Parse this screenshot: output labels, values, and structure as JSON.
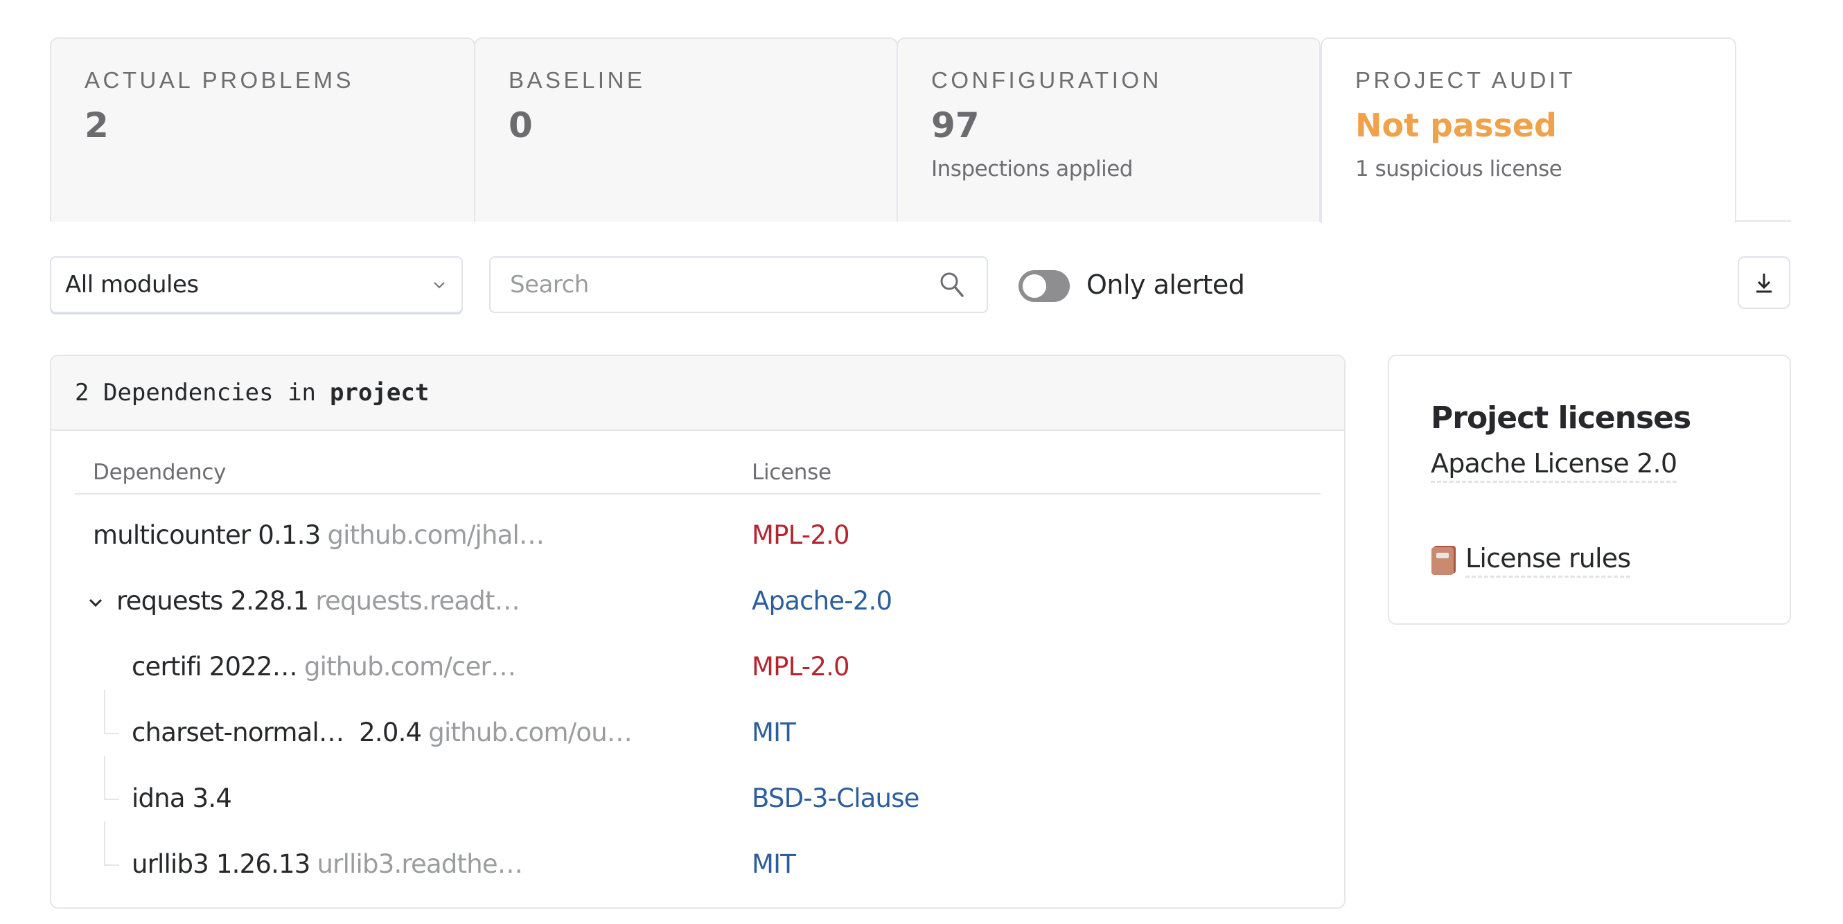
{
  "tabs": [
    {
      "title": "ACTUAL PROBLEMS",
      "value": "2",
      "subtitle": ""
    },
    {
      "title": "BASELINE",
      "value": "0",
      "subtitle": ""
    },
    {
      "title": "CONFIGURATION",
      "value": "97",
      "subtitle": "Inspections applied"
    },
    {
      "title": "PROJECT AUDIT",
      "value": "Not passed",
      "subtitle": "1 suspicious license",
      "active": true,
      "value_color": "#f0a24a"
    }
  ],
  "toolbar": {
    "module_select": {
      "value": "All modules",
      "icon": "chevron-down-icon"
    },
    "search": {
      "placeholder": "Search",
      "value": "",
      "icon": "search-icon"
    },
    "only_alerted": {
      "label": "Only alerted",
      "checked": false
    },
    "download_icon": "download-icon"
  },
  "dependencies": {
    "header": {
      "count": "2",
      "text": "Dependencies in",
      "target": "project"
    },
    "columns": {
      "dependency": "Dependency",
      "license": "License"
    },
    "rows": [
      {
        "name": "multicounter 0.1.3",
        "url": "github.com/jhal…",
        "license": "MPL-2.0",
        "license_status": "alert",
        "level": 0,
        "expandable": false
      },
      {
        "name": "requests 2.28.1",
        "url": "requests.readt…",
        "license": "Apache-2.0",
        "license_status": "ok",
        "level": 0,
        "expandable": true,
        "expanded": true
      },
      {
        "name": "certifi 2022…",
        "url": "github.com/cer…",
        "license": "MPL-2.0",
        "license_status": "alert",
        "level": 1
      },
      {
        "name": "charset-normal…  2.0.4",
        "url": "github.com/ou…",
        "license": "MIT",
        "license_status": "ok",
        "level": 1
      },
      {
        "name": "idna 3.4",
        "url": "",
        "license": "BSD-3-Clause",
        "license_status": "ok",
        "level": 1
      },
      {
        "name": "urllib3 1.26.13",
        "url": "urllib3.readthe…",
        "license": "MIT",
        "license_status": "ok",
        "level": 1
      }
    ]
  },
  "project_licenses": {
    "title": "Project licenses",
    "license": "Apache License 2.0",
    "rules_link": "License rules",
    "rules_icon": "book-icon"
  },
  "colors": {
    "warning": "#f0a24a",
    "license_alert": "#b3262f",
    "license_ok": "#2c5e9c"
  }
}
